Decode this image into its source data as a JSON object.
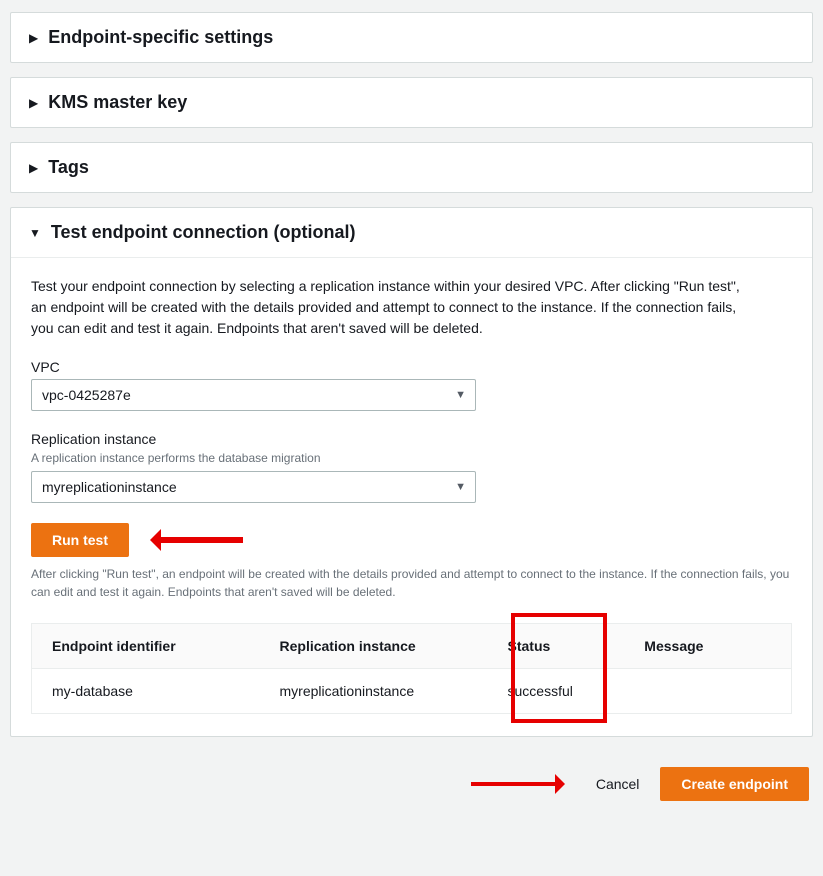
{
  "panels": {
    "endpointSettings": {
      "title": "Endpoint-specific settings"
    },
    "kms": {
      "title": "KMS master key"
    },
    "tags": {
      "title": "Tags"
    },
    "testConn": {
      "title": "Test endpoint connection (optional)",
      "description": "Test your endpoint connection by selecting a replication instance within your desired VPC. After clicking \"Run test\", an endpoint will be created with the details provided and attempt to connect to the instance. If the connection fails, you can edit and test it again. Endpoints that aren't saved will be deleted.",
      "vpc": {
        "label": "VPC",
        "value": "vpc-0425287e"
      },
      "replInstance": {
        "label": "Replication instance",
        "hint": "A replication instance performs the database migration",
        "value": "myreplicationinstance"
      },
      "runTestLabel": "Run test",
      "runTestHint": "After clicking \"Run test\", an endpoint will be created with the details provided and attempt to connect to the instance. If the connection fails, you can edit and test it again. Endpoints that aren't saved will be deleted.",
      "table": {
        "headers": {
          "endpoint": "Endpoint identifier",
          "repl": "Replication instance",
          "status": "Status",
          "message": "Message"
        },
        "row": {
          "endpoint": "my-database",
          "repl": "myreplicationinstance",
          "status": "successful",
          "message": ""
        }
      }
    }
  },
  "footer": {
    "cancel": "Cancel",
    "create": "Create endpoint"
  }
}
